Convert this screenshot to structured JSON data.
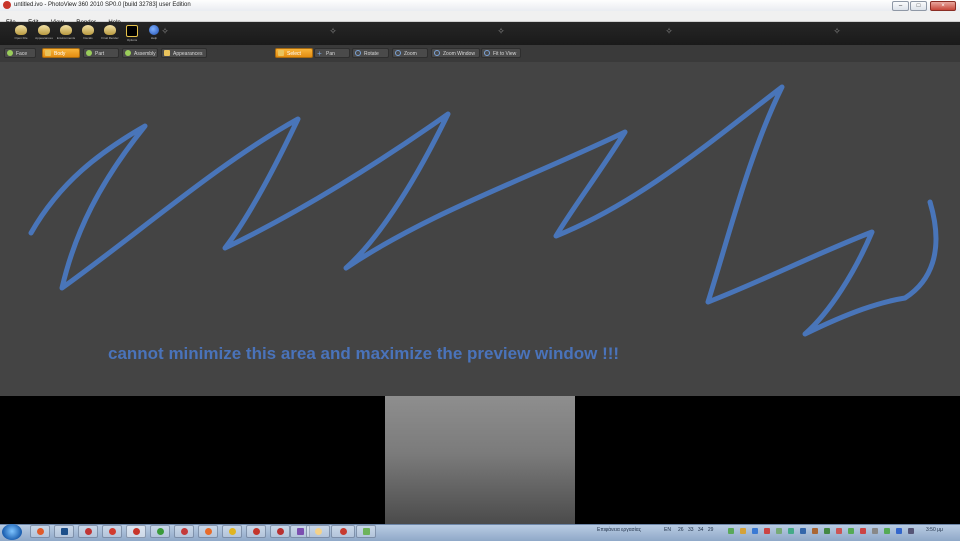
{
  "window": {
    "title": "untitled.ivo - PhotoView 360 2010 SP0.0 [build 32783] user Edition",
    "buttons": [
      "–",
      "□",
      "×"
    ]
  },
  "menu": [
    "File",
    "Edit",
    "View",
    "Render",
    "Help"
  ],
  "toolbar": {
    "tools": [
      {
        "label": "Open File",
        "icon": "open-file-icon"
      },
      {
        "label": "Appearances",
        "icon": "appearances-icon"
      },
      {
        "label": "Environments",
        "icon": "environment-icon"
      },
      {
        "label": "Decals",
        "icon": "decals-icon"
      },
      {
        "label": "Final Render",
        "icon": "final-render-icon"
      },
      {
        "label": "Options",
        "icon": "render-options-icon"
      },
      {
        "label": "Help",
        "icon": "help-icon"
      }
    ]
  },
  "modebar": {
    "left": [
      {
        "label": "Face",
        "active": false
      },
      {
        "label": "Body",
        "active": true
      },
      {
        "label": "Part",
        "active": false
      },
      {
        "label": "Assembly",
        "active": false
      },
      {
        "label": "Appearances",
        "active": false
      }
    ],
    "view": [
      {
        "label": "Select",
        "active": true
      },
      {
        "label": "Pan",
        "active": false
      },
      {
        "label": "Rotate",
        "active": false
      },
      {
        "label": "Zoom",
        "active": false
      },
      {
        "label": "Zoom Window",
        "active": false
      },
      {
        "label": "Fit to View",
        "active": false
      }
    ]
  },
  "annotation": {
    "text": "cannot minimize this area and maximize the preview window !!!",
    "color": "#4a73ba"
  },
  "taskbar": {
    "status_text": "Επιφάνεια εργασίας",
    "language": "EN",
    "tray_numbers": [
      "26",
      "33",
      "34",
      "29"
    ],
    "clock": "3:50 μμ"
  },
  "colors": {
    "viewport_bg": "#444444",
    "accent_orange": "#f0a020",
    "annotation_blue": "#4a73ba"
  }
}
